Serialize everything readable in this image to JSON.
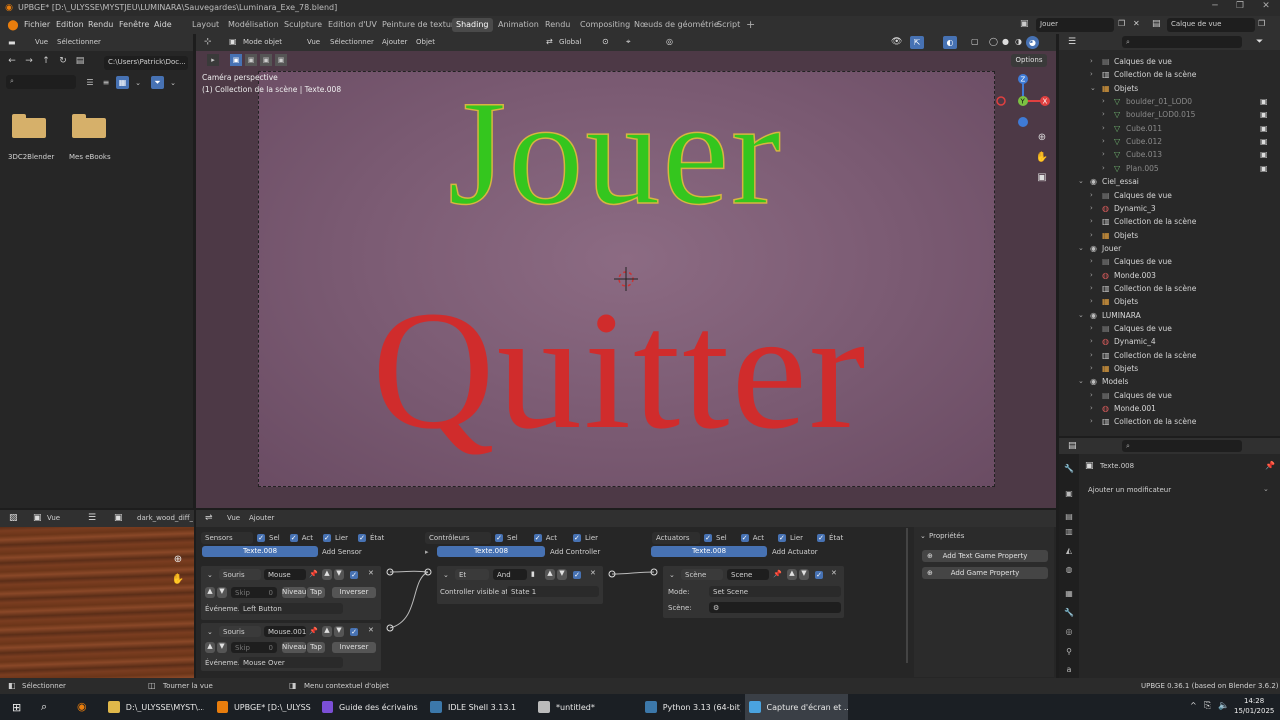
{
  "window": {
    "title": "UPBGE* [D:\\_ULYSSE\\MYSTJEU\\LUMINARA\\Sauvegardes\\Luminara_Exe_78.blend]"
  },
  "menu": [
    "Fichier",
    "Edition",
    "Rendu",
    "Fenêtre",
    "Aide"
  ],
  "workspaces": [
    {
      "label": "Layout",
      "active": false
    },
    {
      "label": "Modélisation",
      "active": false
    },
    {
      "label": "Sculpture",
      "active": false
    },
    {
      "label": "Edition d'UV",
      "active": false
    },
    {
      "label": "Peinture de texture",
      "active": false
    },
    {
      "label": "Shading",
      "active": true
    },
    {
      "label": "Animation",
      "active": false
    },
    {
      "label": "Rendu",
      "active": false
    },
    {
      "label": "Compositing",
      "active": false
    },
    {
      "label": "Nœuds de géométrie",
      "active": false
    },
    {
      "label": "Script",
      "active": false
    }
  ],
  "scene_selector": "Jouer",
  "viewlayer_selector": "Calque de vue",
  "file_browser": {
    "menu": [
      "Vue",
      "Sélectionner"
    ],
    "path": "C:\\Users\\Patrick\\Doc...",
    "items": [
      {
        "label": "3DC2Blender"
      },
      {
        "label": "Mes eBooks"
      }
    ]
  },
  "viewport": {
    "mode": "Mode objet",
    "menu": [
      "Vue",
      "Sélectionner",
      "Ajouter",
      "Objet"
    ],
    "orientation": "Global",
    "options": "Options",
    "camera_label": "Caméra perspective",
    "collection_label": "(1) Collection de la scène | Texte.008",
    "text_jouer": "Jouer",
    "text_quitter": "Quitter"
  },
  "outliner": {
    "rows": [
      {
        "indent": 1,
        "label": "Calques de vue",
        "type": "view"
      },
      {
        "indent": 1,
        "label": "Collection de la scène",
        "type": "coll"
      },
      {
        "indent": 1,
        "label": "Objets",
        "type": "obj",
        "open": true
      },
      {
        "indent": 2,
        "label": "boulder_01_LOD0",
        "type": "mesh",
        "dim": true
      },
      {
        "indent": 2,
        "label": "boulder_LOD0.015",
        "type": "mesh",
        "dim": true
      },
      {
        "indent": 2,
        "label": "Cube.011",
        "type": "mesh",
        "dim": true
      },
      {
        "indent": 2,
        "label": "Cube.012",
        "type": "mesh",
        "dim": true
      },
      {
        "indent": 2,
        "label": "Cube.013",
        "type": "mesh",
        "dim": true
      },
      {
        "indent": 2,
        "label": "Plan.005",
        "type": "mesh",
        "dim": true
      },
      {
        "indent": 0,
        "label": "Ciel_essai",
        "type": "scene",
        "open": true
      },
      {
        "indent": 1,
        "label": "Calques de vue",
        "type": "view"
      },
      {
        "indent": 1,
        "label": "Dynamic_3",
        "type": "world"
      },
      {
        "indent": 1,
        "label": "Collection de la scène",
        "type": "coll"
      },
      {
        "indent": 1,
        "label": "Objets",
        "type": "obj"
      },
      {
        "indent": 0,
        "label": "Jouer",
        "type": "scene",
        "open": true
      },
      {
        "indent": 1,
        "label": "Calques de vue",
        "type": "view"
      },
      {
        "indent": 1,
        "label": "Monde.003",
        "type": "world"
      },
      {
        "indent": 1,
        "label": "Collection de la scène",
        "type": "coll"
      },
      {
        "indent": 1,
        "label": "Objets",
        "type": "obj"
      },
      {
        "indent": 0,
        "label": "LUMINARA",
        "type": "scene",
        "open": true
      },
      {
        "indent": 1,
        "label": "Calques de vue",
        "type": "view"
      },
      {
        "indent": 1,
        "label": "Dynamic_4",
        "type": "world"
      },
      {
        "indent": 1,
        "label": "Collection de la scène",
        "type": "coll"
      },
      {
        "indent": 1,
        "label": "Objets",
        "type": "obj"
      },
      {
        "indent": 0,
        "label": "Models",
        "type": "scene",
        "open": true
      },
      {
        "indent": 1,
        "label": "Calques de vue",
        "type": "view"
      },
      {
        "indent": 1,
        "label": "Monde.001",
        "type": "world"
      },
      {
        "indent": 1,
        "label": "Collection de la scène",
        "type": "coll"
      }
    ]
  },
  "properties": {
    "object_name": "Texte.008",
    "add_modifier": "Ajouter un modificateur"
  },
  "image_editor": {
    "menu": "Vue",
    "image": "dark_wood_diff_1"
  },
  "logic": {
    "menu": [
      "Vue",
      "Ajouter"
    ],
    "sensors": {
      "title": "Sensors",
      "sel": "Sel",
      "act": "Act",
      "link": "Lier",
      "state": "État",
      "object": "Texte.008",
      "add": "Add Sensor",
      "items": [
        {
          "type": "Souris",
          "name": "Mouse",
          "skip": "Skip",
          "skip_val": "0",
          "level": "Niveau",
          "tap": "Tap",
          "invert": "Inverser",
          "event_label": "Événeme...",
          "event": "Left Button"
        },
        {
          "type": "Souris",
          "name": "Mouse.001",
          "skip": "Skip",
          "skip_val": "0",
          "level": "Niveau",
          "tap": "Tap",
          "invert": "Inverser",
          "event_label": "Événeme...",
          "event": "Mouse Over"
        }
      ]
    },
    "controllers": {
      "title": "Contrôleurs",
      "sel": "Sel",
      "act": "Act",
      "link": "Lier",
      "object": "Texte.008",
      "add": "Add Controller",
      "item": {
        "type": "Et",
        "name": "And",
        "visible_label": "Controller visible at:",
        "visible_val": "State 1"
      }
    },
    "actuators": {
      "title": "Actuators",
      "sel": "Sel",
      "act": "Act",
      "link": "Lier",
      "state": "État",
      "object": "Texte.008",
      "add": "Add Actuator",
      "item": {
        "type": "Scène",
        "name": "Scene",
        "mode_label": "Mode:",
        "mode": "Set Scene",
        "scene_label": "Scène:"
      }
    },
    "properties": {
      "title": "Propriétés",
      "add_text": "Add Text Game Property",
      "add": "Add Game Property"
    }
  },
  "status": {
    "select": "Sélectionner",
    "rotate": "Tourner la vue",
    "context": "Menu contextuel d'objet",
    "version": "UPBGE 0.36.1 (based on Blender 3.6.2)"
  },
  "taskbar": {
    "items": [
      {
        "label": "D:\\_ULYSSE\\MYST\\...",
        "color": "#e0b84a"
      },
      {
        "label": "UPBGE* [D:\\_ULYSS...",
        "color": "#e87d0d"
      },
      {
        "label": "Guide des écrivains...",
        "color": "#7b4fd6"
      },
      {
        "label": "IDLE Shell 3.13.1",
        "color": "#3c78aa"
      },
      {
        "label": "*untitled*",
        "color": "#bbbbbb"
      },
      {
        "label": "Python 3.13 (64-bit)",
        "color": "#3c78aa"
      },
      {
        "label": "Capture d'écran et ...",
        "color": "#4aa3df"
      }
    ],
    "time": "14:28",
    "date": "15/01/2025"
  },
  "colors": {
    "accent": "#4772b3",
    "jouer": "#34c61e",
    "quitter": "#d02c2c"
  }
}
